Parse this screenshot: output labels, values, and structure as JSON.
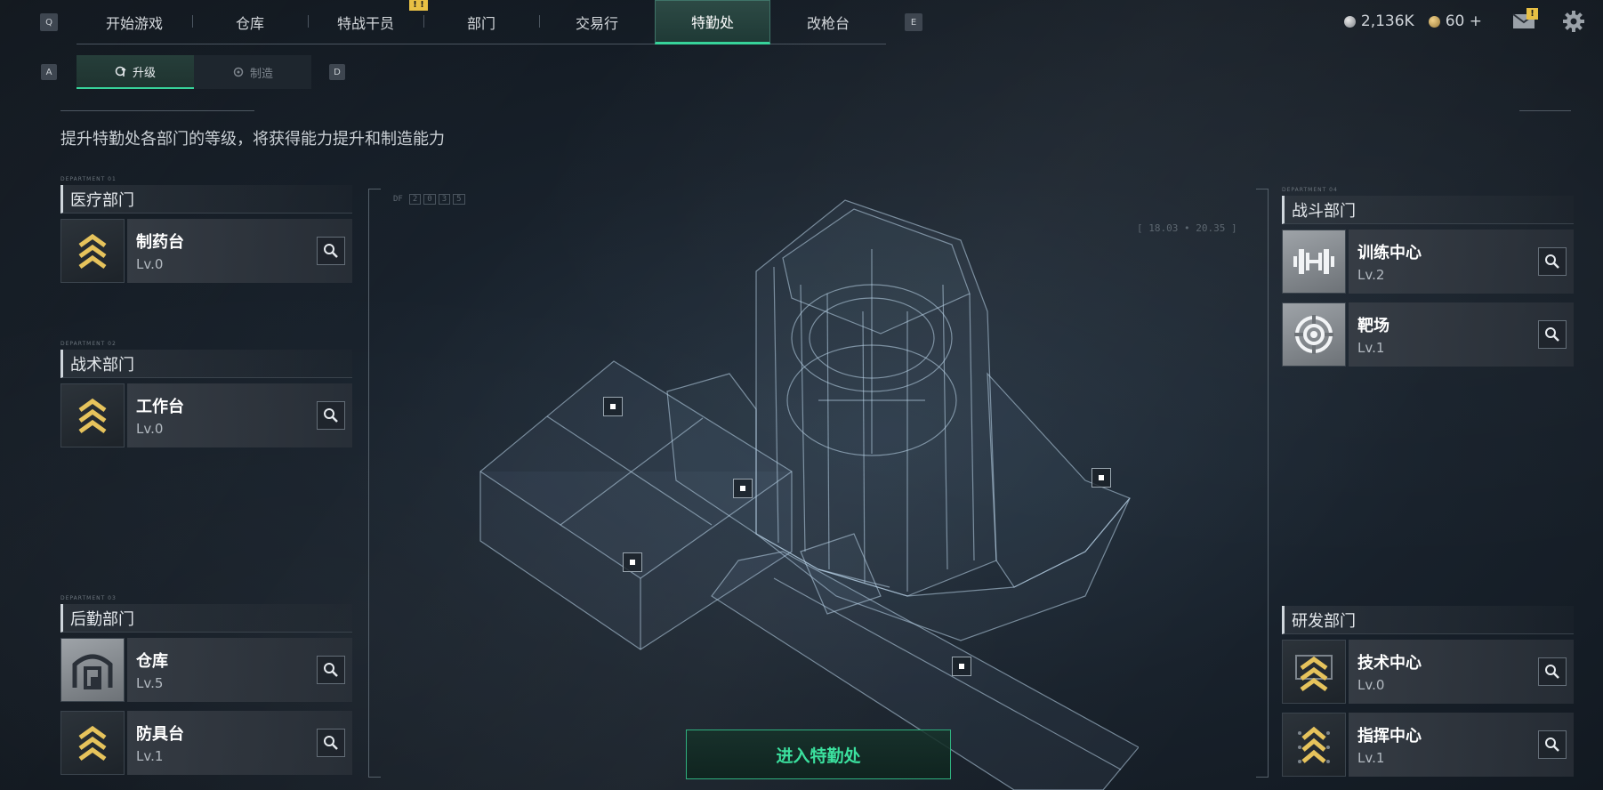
{
  "nav": {
    "left_key": "Q",
    "right_key": "E",
    "tabs": [
      {
        "label": "开始游戏"
      },
      {
        "label": "仓库"
      },
      {
        "label": "特战干员",
        "badge": "!"
      },
      {
        "label": "部门",
        "badge": "!"
      },
      {
        "label": "交易行"
      },
      {
        "label": "特勤处",
        "active": true
      },
      {
        "label": "改枪台"
      }
    ]
  },
  "resources": {
    "silver": "2,136K",
    "gold": "60 +",
    "mail_badge": "!"
  },
  "subnav": {
    "left_key": "A",
    "right_key": "D",
    "upgrade_label": "升级",
    "craft_label": "制造"
  },
  "subtitle": "提升特勤处各部门的等级，将获得能力提升和制造能力",
  "hud": {
    "df_label": "DF",
    "df_digits": [
      "2",
      "0",
      "3",
      "5"
    ],
    "coords": "[ 18.03 • 20.35 ]"
  },
  "departments": {
    "medical": {
      "tag": "DEPARTMENT 01",
      "title": "医疗部门",
      "items": [
        {
          "name": "制药台",
          "level": "Lv.0",
          "icon": "chevron-upgrade-icon"
        }
      ]
    },
    "tactical": {
      "tag": "DEPARTMENT 02",
      "title": "战术部门",
      "items": [
        {
          "name": "工作台",
          "level": "Lv.0",
          "icon": "chevron-upgrade-icon"
        }
      ]
    },
    "logistics": {
      "tag": "DEPARTMENT 03",
      "title": "后勤部门",
      "items": [
        {
          "name": "仓库",
          "level": "Lv.5",
          "icon": "warehouse-icon"
        },
        {
          "name": "防具台",
          "level": "Lv.1",
          "icon": "chevron-upgrade-icon"
        }
      ]
    },
    "combat": {
      "tag": "DEPARTMENT 04",
      "title": "战斗部门",
      "items": [
        {
          "name": "训练中心",
          "level": "Lv.2",
          "icon": "dumbbell-icon"
        },
        {
          "name": "靶场",
          "level": "Lv.1",
          "icon": "target-icon"
        }
      ]
    },
    "research": {
      "title": "研发部门",
      "items": [
        {
          "name": "技术中心",
          "level": "Lv.0",
          "icon": "chevron-upgrade-icon"
        },
        {
          "name": "指挥中心",
          "level": "Lv.1",
          "icon": "chevron-upgrade-icon"
        }
      ]
    }
  },
  "enter_button": "进入特勤处",
  "colors": {
    "accent_green": "#37d39a",
    "badge_yellow": "#e8c044",
    "upgrade_chevron": "#e6c35c"
  }
}
